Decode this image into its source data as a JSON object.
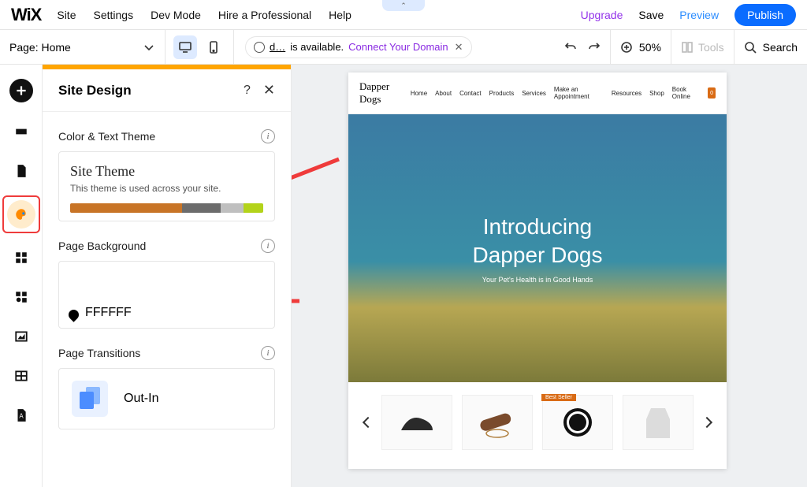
{
  "top": {
    "logo": "WiX",
    "menu": [
      "Site",
      "Settings",
      "Dev Mode",
      "Hire a Professional",
      "Help"
    ],
    "upgrade": "Upgrade",
    "save": "Save",
    "preview": "Preview",
    "publish": "Publish"
  },
  "toolbar": {
    "page_label": "Page:",
    "page_value": "Home",
    "domain_prefix": "d…",
    "domain_status": "is available.",
    "domain_cta": "Connect Your Domain",
    "zoom": "50%",
    "tools": "Tools",
    "search": "Search"
  },
  "panel": {
    "title": "Site Design",
    "sections": {
      "theme_label": "Color & Text Theme",
      "theme_card_title": "Site Theme",
      "theme_card_sub": "This theme is used across your site.",
      "bg_label": "Page Background",
      "bg_value": "FFFFFF",
      "trans_label": "Page Transitions",
      "trans_value": "Out-In"
    },
    "palette": [
      "#c87426",
      "#c87426",
      "#6c6c6c",
      "#bfbfbf",
      "#b3d31a"
    ],
    "palette_widths": [
      38,
      20,
      20,
      12,
      10
    ]
  },
  "preview_site": {
    "logo": "Dapper Dogs",
    "nav": [
      "Home",
      "About",
      "Contact",
      "Products",
      "Services",
      "Make an Appointment",
      "Resources",
      "Shop",
      "Book Online"
    ],
    "cart_count": "0",
    "hero_line1": "Introducing",
    "hero_line2": "Dapper Dogs",
    "hero_sub": "Your Pet's Health is in Good Hands",
    "badge": "Best Seller"
  }
}
